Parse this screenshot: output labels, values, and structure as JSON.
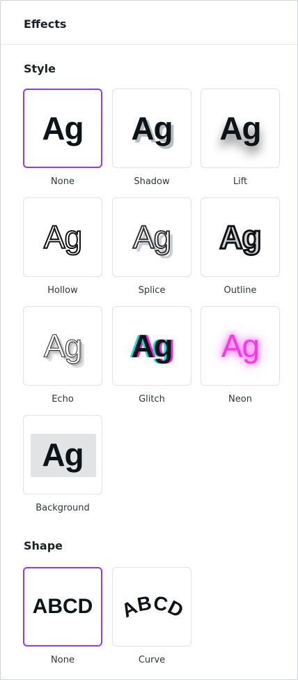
{
  "panel": {
    "title": "Effects"
  },
  "style": {
    "title": "Style",
    "sample": "Ag",
    "options": [
      {
        "label": "None",
        "selected": true
      },
      {
        "label": "Shadow",
        "selected": false
      },
      {
        "label": "Lift",
        "selected": false
      },
      {
        "label": "Hollow",
        "selected": false
      },
      {
        "label": "Splice",
        "selected": false
      },
      {
        "label": "Outline",
        "selected": false
      },
      {
        "label": "Echo",
        "selected": false
      },
      {
        "label": "Glitch",
        "selected": false
      },
      {
        "label": "Neon",
        "selected": false
      },
      {
        "label": "Background",
        "selected": false
      }
    ]
  },
  "shape": {
    "title": "Shape",
    "sample": "ABCD",
    "options": [
      {
        "label": "None",
        "selected": true
      },
      {
        "label": "Curve",
        "selected": false
      }
    ]
  },
  "colors": {
    "selected_border": "#8b3dff",
    "neon": "#f33ae6",
    "glitch_cyan": "#18e0e0",
    "glitch_magenta": "#ff1ad9"
  }
}
